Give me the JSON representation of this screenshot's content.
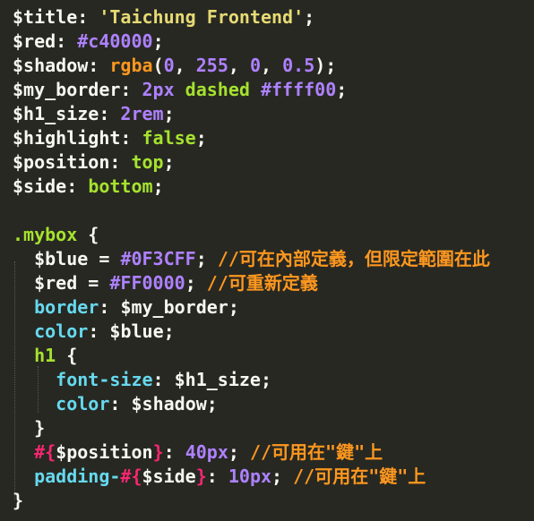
{
  "editor": {
    "background": "#272822",
    "lines": [
      {
        "tokens": [
          {
            "text": "$title",
            "cls": "tok-var"
          },
          {
            "text": ": ",
            "cls": "tok-punc"
          },
          {
            "text": "'Taichung Frontend'",
            "cls": "tok-str"
          },
          {
            "text": ";",
            "cls": "tok-punc"
          }
        ]
      },
      {
        "tokens": [
          {
            "text": "$red",
            "cls": "tok-var"
          },
          {
            "text": ": ",
            "cls": "tok-punc"
          },
          {
            "text": "#c40000",
            "cls": "tok-num"
          },
          {
            "text": ";",
            "cls": "tok-punc"
          }
        ]
      },
      {
        "tokens": [
          {
            "text": "$shadow",
            "cls": "tok-var"
          },
          {
            "text": ": ",
            "cls": "tok-punc"
          },
          {
            "text": "rgba",
            "cls": "tok-func"
          },
          {
            "text": "(",
            "cls": "tok-punc"
          },
          {
            "text": "0",
            "cls": "tok-num"
          },
          {
            "text": ", ",
            "cls": "tok-punc"
          },
          {
            "text": "255",
            "cls": "tok-num"
          },
          {
            "text": ", ",
            "cls": "tok-punc"
          },
          {
            "text": "0",
            "cls": "tok-num"
          },
          {
            "text": ", ",
            "cls": "tok-punc"
          },
          {
            "text": "0.5",
            "cls": "tok-num"
          },
          {
            "text": ");",
            "cls": "tok-punc"
          }
        ]
      },
      {
        "tokens": [
          {
            "text": "$my_border",
            "cls": "tok-var"
          },
          {
            "text": ": ",
            "cls": "tok-punc"
          },
          {
            "text": "2px",
            "cls": "tok-num"
          },
          {
            "text": " dashed ",
            "cls": "tok-plain"
          },
          {
            "text": "#ffff00",
            "cls": "tok-num"
          },
          {
            "text": ";",
            "cls": "tok-punc"
          }
        ]
      },
      {
        "tokens": [
          {
            "text": "$h1_size",
            "cls": "tok-var"
          },
          {
            "text": ": ",
            "cls": "tok-punc"
          },
          {
            "text": "2rem",
            "cls": "tok-num"
          },
          {
            "text": ";",
            "cls": "tok-punc"
          }
        ]
      },
      {
        "tokens": [
          {
            "text": "$highlight",
            "cls": "tok-var"
          },
          {
            "text": ": ",
            "cls": "tok-punc"
          },
          {
            "text": "false",
            "cls": "tok-plain"
          },
          {
            "text": ";",
            "cls": "tok-punc"
          }
        ]
      },
      {
        "tokens": [
          {
            "text": "$position",
            "cls": "tok-var"
          },
          {
            "text": ": ",
            "cls": "tok-punc"
          },
          {
            "text": "top",
            "cls": "tok-plain"
          },
          {
            "text": ";",
            "cls": "tok-punc"
          }
        ]
      },
      {
        "tokens": [
          {
            "text": "$side",
            "cls": "tok-var"
          },
          {
            "text": ": ",
            "cls": "tok-punc"
          },
          {
            "text": "bottom",
            "cls": "tok-plain"
          },
          {
            "text": ";",
            "cls": "tok-punc"
          }
        ]
      },
      {
        "tokens": []
      },
      {
        "tokens": [
          {
            "text": ".mybox",
            "cls": "tok-sel"
          },
          {
            "text": " {",
            "cls": "tok-punc"
          }
        ]
      },
      {
        "tokens": [
          {
            "text": "  ",
            "cls": "tok-punc"
          },
          {
            "text": "$blue",
            "cls": "tok-var"
          },
          {
            "text": " = ",
            "cls": "tok-punc"
          },
          {
            "text": "#0F3CFF",
            "cls": "tok-num"
          },
          {
            "text": "; ",
            "cls": "tok-punc"
          },
          {
            "text": "//可在內部定義，但限定範圍在此",
            "cls": "tok-cmt"
          }
        ]
      },
      {
        "tokens": [
          {
            "text": "  ",
            "cls": "tok-punc"
          },
          {
            "text": "$red",
            "cls": "tok-var"
          },
          {
            "text": " = ",
            "cls": "tok-punc"
          },
          {
            "text": "#FF0000",
            "cls": "tok-num"
          },
          {
            "text": "; ",
            "cls": "tok-punc"
          },
          {
            "text": "//可重新定義",
            "cls": "tok-cmt"
          }
        ]
      },
      {
        "tokens": [
          {
            "text": "  ",
            "cls": "tok-punc"
          },
          {
            "text": "border",
            "cls": "tok-prop"
          },
          {
            "text": ": ",
            "cls": "tok-punc"
          },
          {
            "text": "$my_border",
            "cls": "tok-var"
          },
          {
            "text": ";",
            "cls": "tok-punc"
          }
        ]
      },
      {
        "tokens": [
          {
            "text": "  ",
            "cls": "tok-punc"
          },
          {
            "text": "color",
            "cls": "tok-prop"
          },
          {
            "text": ": ",
            "cls": "tok-punc"
          },
          {
            "text": "$blue",
            "cls": "tok-var"
          },
          {
            "text": ";",
            "cls": "tok-punc"
          }
        ]
      },
      {
        "tokens": [
          {
            "text": "  ",
            "cls": "tok-punc"
          },
          {
            "text": "h1",
            "cls": "tok-sel"
          },
          {
            "text": " {",
            "cls": "tok-punc"
          }
        ]
      },
      {
        "tokens": [
          {
            "text": "    ",
            "cls": "tok-punc"
          },
          {
            "text": "font-size",
            "cls": "tok-prop"
          },
          {
            "text": ": ",
            "cls": "tok-punc"
          },
          {
            "text": "$h1_size",
            "cls": "tok-var"
          },
          {
            "text": ";",
            "cls": "tok-punc"
          }
        ]
      },
      {
        "tokens": [
          {
            "text": "    ",
            "cls": "tok-punc"
          },
          {
            "text": "color",
            "cls": "tok-prop"
          },
          {
            "text": ": ",
            "cls": "tok-punc"
          },
          {
            "text": "$shadow",
            "cls": "tok-var"
          },
          {
            "text": ";",
            "cls": "tok-punc"
          }
        ]
      },
      {
        "tokens": [
          {
            "text": "  }",
            "cls": "tok-punc"
          }
        ]
      },
      {
        "tokens": [
          {
            "text": "  ",
            "cls": "tok-punc"
          },
          {
            "text": "#{",
            "cls": "tok-brace"
          },
          {
            "text": "$position",
            "cls": "tok-var"
          },
          {
            "text": "}",
            "cls": "tok-brace"
          },
          {
            "text": ": ",
            "cls": "tok-punc"
          },
          {
            "text": "40px",
            "cls": "tok-num"
          },
          {
            "text": "; ",
            "cls": "tok-punc"
          },
          {
            "text": "//可用在\"鍵\"上",
            "cls": "tok-cmt"
          }
        ]
      },
      {
        "tokens": [
          {
            "text": "  ",
            "cls": "tok-punc"
          },
          {
            "text": "padding-",
            "cls": "tok-prop"
          },
          {
            "text": "#{",
            "cls": "tok-brace"
          },
          {
            "text": "$side",
            "cls": "tok-var"
          },
          {
            "text": "}",
            "cls": "tok-brace"
          },
          {
            "text": ": ",
            "cls": "tok-punc"
          },
          {
            "text": "10px",
            "cls": "tok-num"
          },
          {
            "text": "; ",
            "cls": "tok-punc"
          },
          {
            "text": "//可用在\"鍵\"上",
            "cls": "tok-cmt"
          }
        ]
      },
      {
        "tokens": [
          {
            "text": "}",
            "cls": "tok-punc"
          }
        ]
      }
    ]
  }
}
